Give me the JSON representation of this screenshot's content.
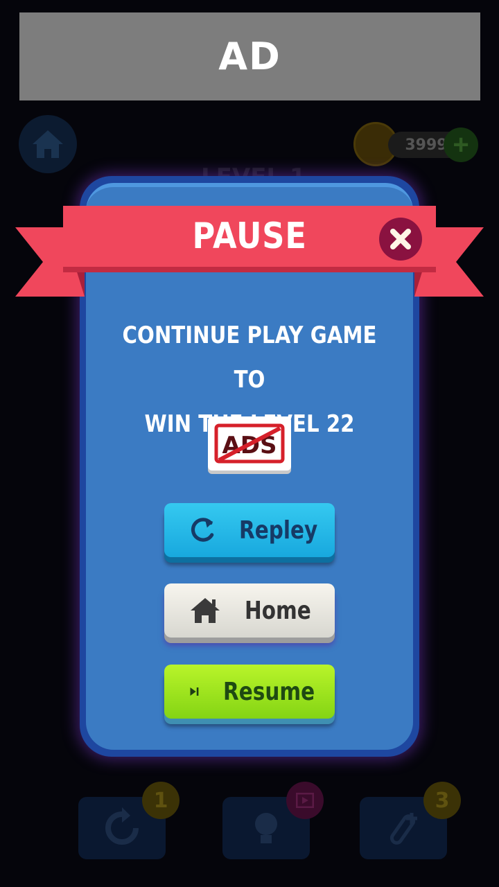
{
  "ad_banner": {
    "label": "AD"
  },
  "background": {
    "coins": "3999",
    "level_label": "LEVEL 1",
    "tools": [
      {
        "name": "undo",
        "badge": "1"
      },
      {
        "name": "hint",
        "badge": ""
      },
      {
        "name": "add-tube",
        "badge": "3"
      }
    ]
  },
  "dialog": {
    "title": "PAUSE",
    "message_line1": "CONTINUE PLAY GAME TO",
    "message_line2": "WIN THE LEVEL 22",
    "no_ads_label": "ADS",
    "buttons": {
      "replay": "Repley",
      "home": "Home",
      "resume": "Resume"
    }
  },
  "colors": {
    "ribbon": "#f0475c",
    "panel": "#3b7bc3",
    "replay": "#1fb4e6",
    "home": "#ecebe4",
    "resume": "#a5e61f"
  }
}
